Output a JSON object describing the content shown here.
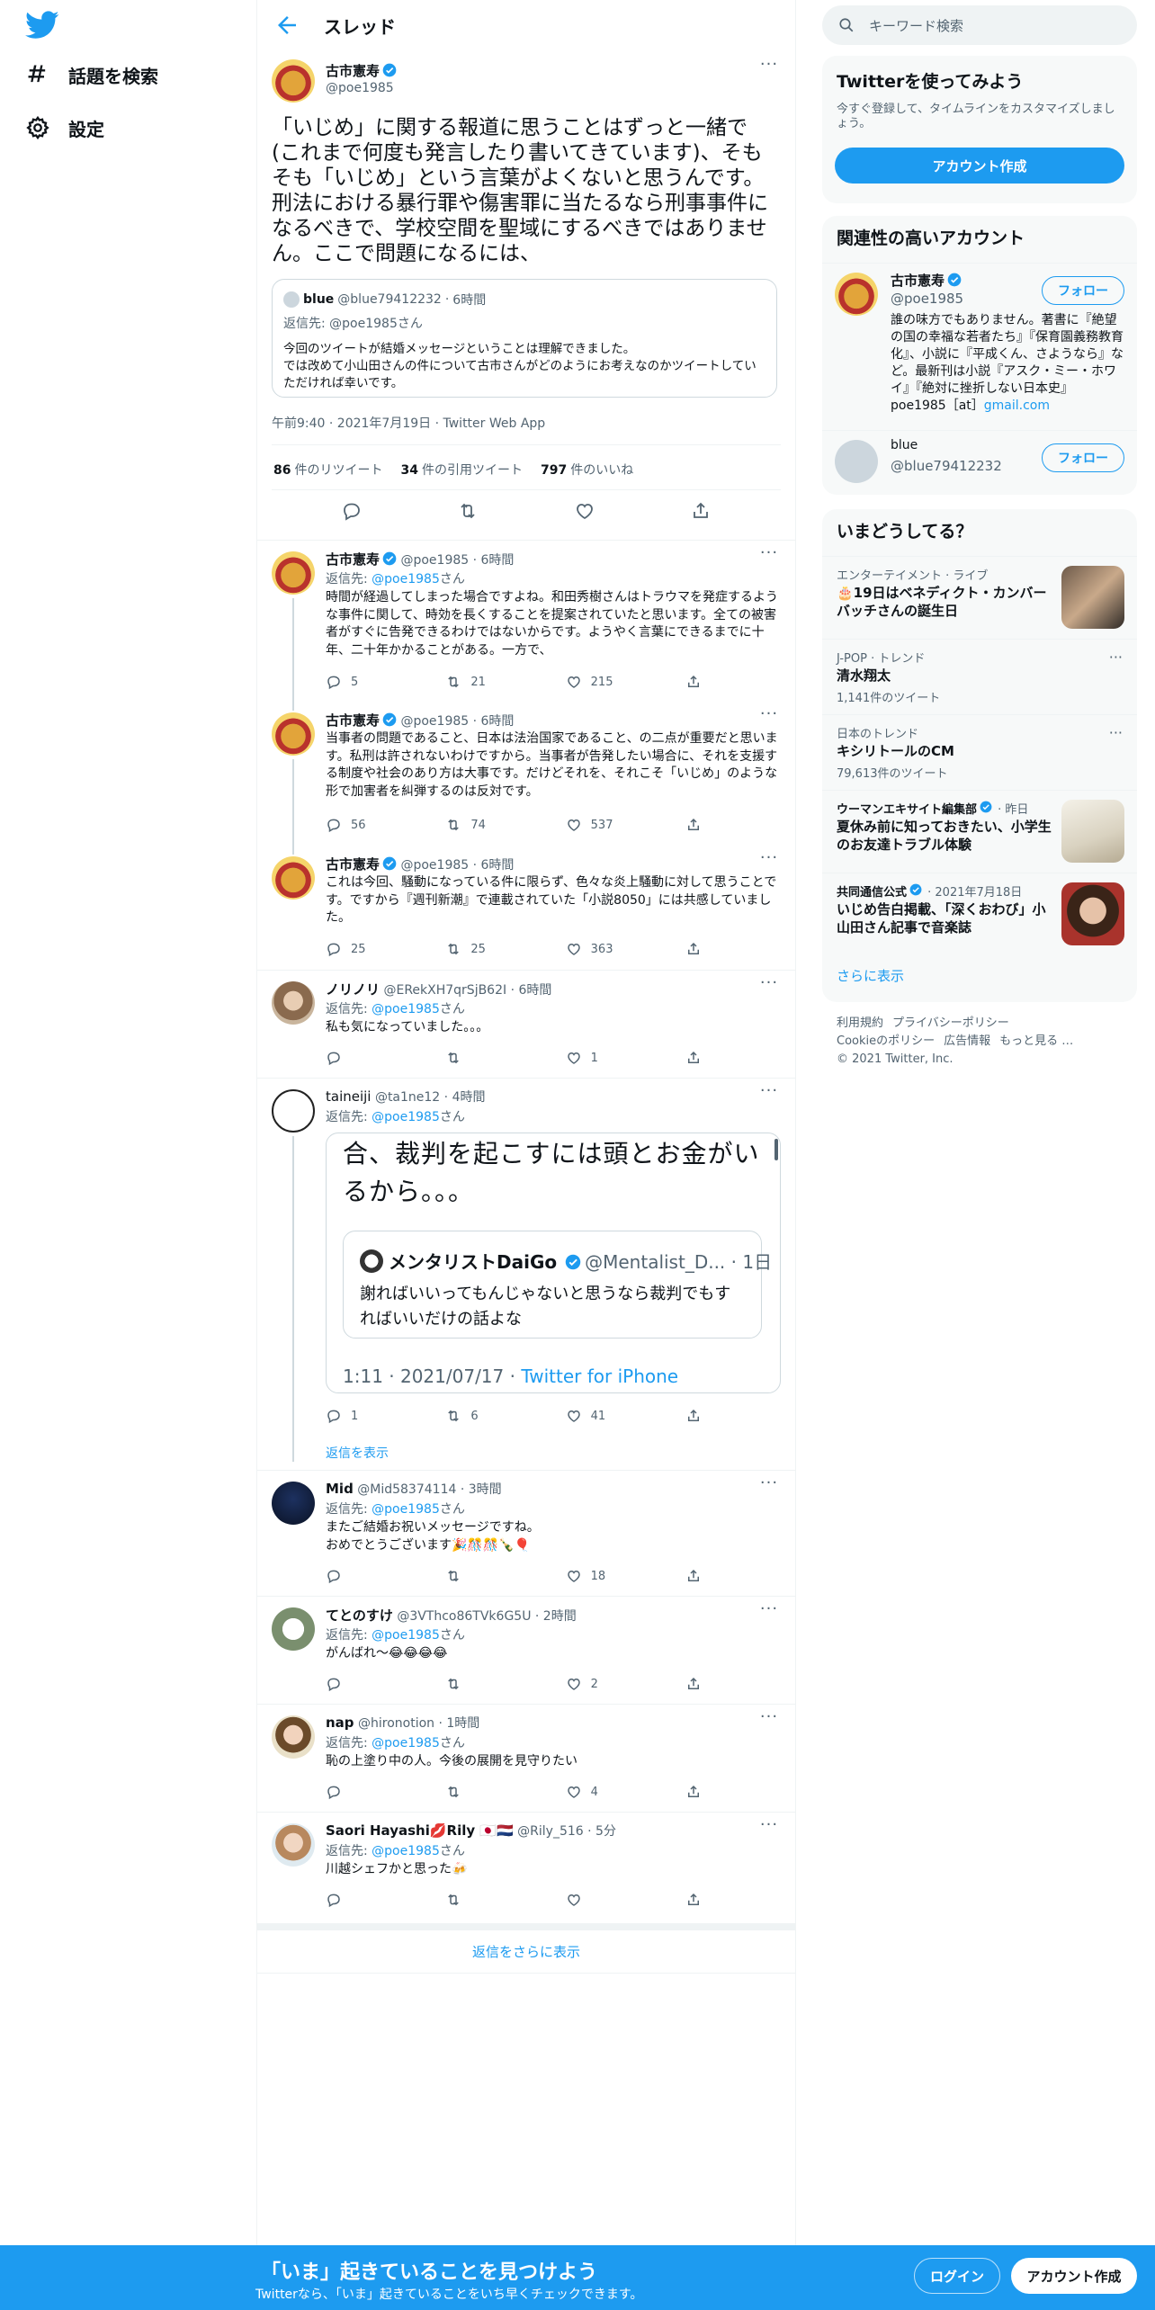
{
  "nav": {
    "explore_label": "話題を検索",
    "settings_label": "設定"
  },
  "header": {
    "title": "スレッド"
  },
  "main_tweet": {
    "name": "古市憲寿",
    "handle": "@poe1985",
    "text": "「いじめ」に関する報道に思うことはずっと一緒で(これまで何度も発言したり書いてきています)、そもそも「いじめ」という言葉がよくないと思うんです。刑法における暴行罪や傷害罪に当たるなら刑事事件になるべきで、学校空間を聖域にするべきではありません。ここで問題になるには、",
    "quote": {
      "name": "blue",
      "handle": "@blue79412232",
      "time": "6時間",
      "reply_to": "返信先: @poe1985さん",
      "text": "今回のツイートが結婚メッセージということは理解できました。\nでは改めて小山田さんの件について古市さんがどのようにお考えなのかツイートしていただければ幸いです。"
    },
    "timestamp": "午前9:40 · 2021年7月19日 · Twitter Web App",
    "stats": {
      "retweets": "86",
      "retweets_label": "件のリツイート",
      "quotes": "34",
      "quotes_label": "件の引用ツイート",
      "likes": "797",
      "likes_label": "件のいいね"
    }
  },
  "replies": [
    {
      "name": "古市憲寿",
      "meta": "@poe1985 · 6時間",
      "reply_to_prefix": "返信先: ",
      "reply_to": "@poe1985",
      "reply_to_suffix": "さん",
      "text": "時間が経過してしまった場合ですよね。和田秀樹さんはトラウマを発症するような事件に関して、時効を長くすることを提案されていたと思います。全ての被害者がすぐに告発できるわけではないからです。ようやく言葉にできるまでに十年、二十年かかることがある。一方で、",
      "replies": "5",
      "retweets": "21",
      "likes": "215"
    },
    {
      "name": "古市憲寿",
      "meta": "@poe1985 · 6時間",
      "reply_to_prefix": "返信先: ",
      "reply_to": "@poe1985",
      "reply_to_suffix": "さん",
      "text": "当事者の問題であること、日本は法治国家であること、の二点が重要だと思います。私刑は許されないわけですから。当事者が告発したい場合に、それを支援する制度や社会のあり方は大事です。だけどそれを、それこそ「いじめ」のような形で加害者を糾弾するのは反対です。",
      "replies": "56",
      "retweets": "74",
      "likes": "537"
    },
    {
      "name": "古市憲寿",
      "meta": "@poe1985 · 6時間",
      "text": "これは今回、騒動になっている件に限らず、色々な炎上騒動に対して思うことです。ですから『週刊新潮』で連載されていた「小説8050」には共感していました。",
      "replies": "25",
      "retweets": "25",
      "likes": "363"
    },
    {
      "name": "ノリノリ",
      "meta": "@ERekXH7qrSjB62I · 6時間",
      "reply_to_prefix": "返信先: ",
      "reply_to": "@poe1985",
      "reply_to_suffix": "さん",
      "text": "私も気になっていました。。。",
      "replies": "",
      "retweets": "",
      "likes": "1"
    },
    {
      "name": "taineiji",
      "meta": "@ta1ne12 · 4時間",
      "reply_to_prefix": "返信先: ",
      "reply_to": "@poe1985",
      "reply_to_suffix": "さん",
      "embed": {
        "big_text": "合、裁判を起こすには頭とお金がいるから。。。",
        "inner_name": "メンタリストDaiGo",
        "inner_meta": "@Mentalist_D... · 1日",
        "inner_text": "謝ればいいってもんじゃないと思うなら裁判でもすればいいだけの話よな",
        "time": "1:11 · 2021/07/17 · ",
        "source": "Twitter for iPhone"
      },
      "replies": "1",
      "retweets": "6",
      "likes": "41",
      "show_replies": "返信を表示"
    },
    {
      "name": "Mid",
      "meta": "@Mid58374114 · 3時間",
      "reply_to_prefix": "返信先: ",
      "reply_to": "@poe1985",
      "reply_to_suffix": "さん",
      "text": "またご結婚お祝いメッセージですね。\nおめでとうございます🎉🎊🎊🍾🎈",
      "replies": "",
      "retweets": "",
      "likes": "18"
    },
    {
      "name": "てとのすけ",
      "meta": "@3VThco86TVk6G5U · 2時間",
      "reply_to_prefix": "返信先: ",
      "reply_to": "@poe1985",
      "reply_to_suffix": "さん",
      "text": "がんばれ～😂😂😂😂",
      "replies": "",
      "retweets": "",
      "likes": "2"
    },
    {
      "name": "nap",
      "meta": "@hironotion · 1時間",
      "reply_to_prefix": "返信先: ",
      "reply_to": "@poe1985",
      "reply_to_suffix": "さん",
      "text": "恥の上塗り中の人。今後の展開を見守りたい",
      "replies": "",
      "retweets": "",
      "likes": "4"
    },
    {
      "name": "Saori Hayashi💋Rily 🇯🇵🇳🇱",
      "meta": "@Rily_516 · 5分",
      "reply_to_prefix": "返信先: ",
      "reply_to": "@poe1985",
      "reply_to_suffix": "さん",
      "text": "川越シェフかと思った🍻",
      "replies": "",
      "retweets": "",
      "likes": ""
    }
  ],
  "more_replies": "返信をさらに表示",
  "search": {
    "placeholder": "キーワード検索"
  },
  "join": {
    "title": "Twitterを使ってみよう",
    "desc": "今すぐ登録して、タイムラインをカスタマイズしましょう。",
    "button": "アカウント作成"
  },
  "relevant": {
    "title": "関連性の高いアカウント",
    "accounts": [
      {
        "name": "古市憲寿",
        "handle": "@poe1985",
        "bio": "誰の味方でもありません。著書に『絶望の国の幸福な若者たち』『保育園義務教育化』、小説に『平成くん、さようなら』など。最新刊は小説『アスク・ミー・ホワイ』『絶対に挫折しない日本史』 poe1985［at］",
        "bio_link": "gmail.com",
        "follow": "フォロー"
      },
      {
        "name": "blue",
        "handle": "@blue79412232",
        "follow": "フォロー"
      }
    ]
  },
  "trends": {
    "title": "いまどうしてる？",
    "items": [
      {
        "category": "エンターテイメント · ライブ",
        "title": "🎂19日はベネディクト・カンバーバッチさんの誕生日",
        "count": ""
      },
      {
        "category": "J-POP · トレンド",
        "title": "清水翔太",
        "count": "1,141件のツイート"
      },
      {
        "category": "日本のトレンド",
        "title": "キシリトールのCM",
        "count": "79,613件のツイート"
      },
      {
        "category_name": "ウーマンエキサイト編集部",
        "category_time": " · 昨日",
        "title": "夏休み前に知っておきたい、小学生のお友達トラブル体験",
        "count": ""
      },
      {
        "category_name": "共同通信公式",
        "category_time": " · 2021年7月18日",
        "title": "いじめ告白掲載、「深くおわび」小山田さん記事で音楽誌",
        "count": ""
      }
    ],
    "show_more": "さらに表示"
  },
  "footer": {
    "terms": "利用規約",
    "privacy": "プライバシーポリシー",
    "cookie": "Cookieのポリシー",
    "ads": "広告情報",
    "more": "もっと見る …",
    "copyright": "© 2021 Twitter, Inc."
  },
  "bottom_bar": {
    "title": "「いま」起きていることを見つけよう",
    "subtitle": "Twitterなら、「いま」起きていることをいち早くチェックできます。",
    "login": "ログイン",
    "signup": "アカウント作成"
  },
  "colors": {
    "accent": "#1d9bf0",
    "text": "#0f1419",
    "secondary": "#536471",
    "border": "#eff3f4"
  }
}
